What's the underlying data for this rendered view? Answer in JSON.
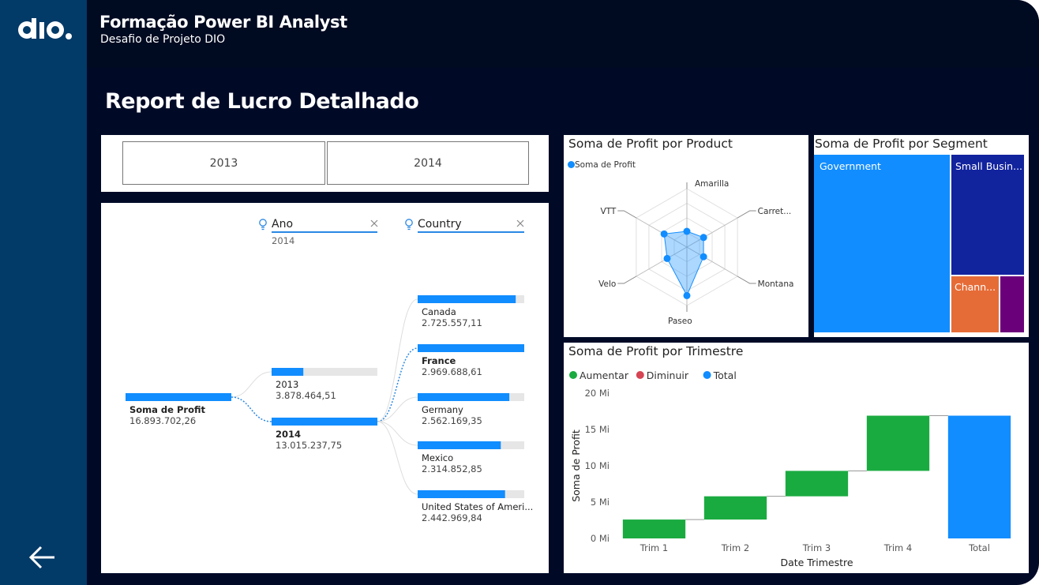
{
  "header": {
    "title": "Formação Power BI Analyst",
    "subtitle": "Desafio de Projeto DIO"
  },
  "page_title": "Report de Lucro Detalhado",
  "slicer": {
    "options": [
      "2013",
      "2014"
    ]
  },
  "decomp": {
    "levels": [
      {
        "label": "Ano",
        "selected": "2014"
      },
      {
        "label": "Country"
      }
    ],
    "root": {
      "label": "Soma de Profit",
      "value": "16.893.702,26"
    },
    "years": [
      {
        "label": "2013",
        "value": "3.878.464,51",
        "frac": 0.3
      },
      {
        "label": "2014",
        "value": "13.015.237,75",
        "frac": 1.0
      }
    ],
    "countries": [
      {
        "label": "Canada",
        "value": "2.725.557,11",
        "frac": 0.92
      },
      {
        "label": "France",
        "value": "2.969.688,61",
        "frac": 1.0
      },
      {
        "label": "Germany",
        "value": "2.562.169,35",
        "frac": 0.86
      },
      {
        "label": "Mexico",
        "value": "2.314.852,85",
        "frac": 0.78
      },
      {
        "label": "United States of Ameri...",
        "value": "2.442.969,84",
        "frac": 0.82
      }
    ]
  },
  "radar": {
    "title": "Soma de Profit por Product",
    "legend": "Soma de Profit",
    "axes": [
      "Amarilla",
      "Carret...",
      "Montana",
      "Paseo",
      "Velo",
      "VTT"
    ],
    "values": [
      0.27,
      0.33,
      0.33,
      0.83,
      0.39,
      0.45
    ]
  },
  "treemap": {
    "title": "Soma de Profit por Segment",
    "items": [
      {
        "label": "Government",
        "color": "#118dff"
      },
      {
        "label": "Small Busin...",
        "color": "#12239e"
      },
      {
        "label": "Chann...",
        "color": "#e66c37"
      },
      {
        "label": "",
        "color": "#6b007b"
      }
    ]
  },
  "chart_data": {
    "type": "bar",
    "subtype": "waterfall",
    "title": "Soma de Profit por Trimestre",
    "xlabel": "Date Trimestre",
    "ylabel": "Soma de Profit",
    "categories": [
      "Trim 1",
      "Trim 2",
      "Trim 3",
      "Trim 4",
      "Total"
    ],
    "values": [
      2.6,
      3.2,
      3.5,
      7.6,
      16.9
    ],
    "yticks": [
      "0 Mi",
      "5 Mi",
      "10 Mi",
      "15 Mi",
      "20 Mi"
    ],
    "ylim": [
      0,
      20
    ],
    "legend": [
      {
        "name": "Aumentar",
        "color": "#1aab40"
      },
      {
        "name": "Diminuir",
        "color": "#d64554"
      },
      {
        "name": "Total",
        "color": "#118dff"
      }
    ],
    "grid": false,
    "legend_position": "top-left"
  }
}
